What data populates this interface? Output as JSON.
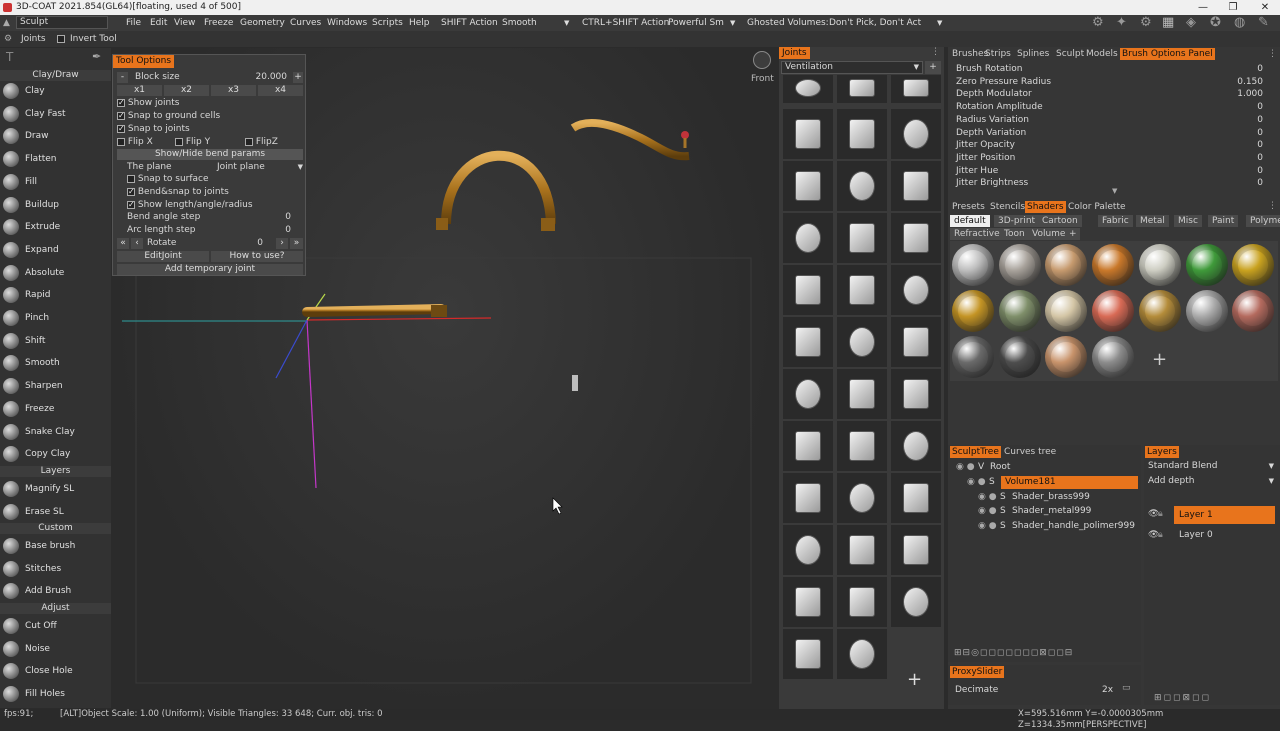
{
  "title": "3D-COAT 2021.854(GL64)[floating, used 4 of 500]",
  "menu": {
    "mode": "Sculpt",
    "items": [
      "File",
      "Edit",
      "View",
      "Freeze",
      "Geometry",
      "Curves",
      "Windows",
      "Scripts",
      "Help"
    ],
    "shift_action_label": "SHIFT Action",
    "shift_action_value": "Smooth",
    "ctrl_shift_label": "CTRL+SHIFT Action",
    "ctrl_shift_value": "Powerful Sm",
    "ghosted_label": "Ghosted Volumes:",
    "ghosted_value": "Don't Pick, Don't Act"
  },
  "row2": {
    "joints": "Joints",
    "invert_tool": "Invert Tool"
  },
  "left_tools": {
    "section_claydraw": "Clay/Draw",
    "claydraw": [
      "Clay",
      "Clay Fast",
      "Draw",
      "Flatten",
      "Fill",
      "Buildup",
      "Extrude",
      "Expand",
      "Absolute",
      "Rapid",
      "Pinch",
      "Shift",
      "Smooth",
      "Sharpen",
      "Freeze",
      "Snake Clay",
      "Copy Clay"
    ],
    "section_layers": "Layers",
    "layers": [
      "Magnify SL",
      "Erase SL"
    ],
    "section_custom": "Custom",
    "custom": [
      "Base brush",
      "Stitches",
      "Add Brush"
    ],
    "section_adjust": "Adjust",
    "adjust": [
      "Cut Off",
      "Noise",
      "Close Hole",
      "Fill Holes"
    ]
  },
  "tool_options": {
    "header": "Tool Options",
    "block_size_label": "Block size",
    "block_size_value": "20.000",
    "multipliers": [
      "x1",
      "x2",
      "x3",
      "x4"
    ],
    "show_joints": "Show joints",
    "snap_ground": "Snap to ground cells",
    "snap_joints": "Snap to joints",
    "flip_x": "Flip X",
    "flip_y": "Flip Y",
    "flip_z": "FlipZ",
    "show_hide_bend": "Show/Hide bend params",
    "the_plane_label": "The plane",
    "the_plane_value": "Joint plane",
    "snap_surface": "Snap to surface",
    "bend_snap": "Bend&snap to joints",
    "show_length": "Show length/angle/radius",
    "bend_angle_label": "Bend angle step",
    "bend_angle_value": "0",
    "arc_length_label": "Arc length step",
    "arc_length_value": "0",
    "rotate_label": "Rotate",
    "rotate_value": "0",
    "edit_joint": "EditJoint",
    "how_to_use": "How to use?",
    "add_temp_joint": "Add temporary joint"
  },
  "viewport": {
    "front_label": "Front"
  },
  "joints_panel": {
    "header": "Joints",
    "category": "Ventilation"
  },
  "brush_params": {
    "tabs": [
      "Brushes",
      "Strips",
      "Splines",
      "Sculpt",
      "Models",
      "Brush Options Panel"
    ],
    "params": [
      {
        "label": "Brush Rotation",
        "value": "0"
      },
      {
        "label": "Zero Pressure Radius",
        "value": "0.150"
      },
      {
        "label": "Depth Modulator",
        "value": "1.000"
      },
      {
        "label": "Rotation Amplitude",
        "value": "0"
      },
      {
        "label": "Radius Variation",
        "value": "0"
      },
      {
        "label": "Depth Variation",
        "value": "0"
      },
      {
        "label": "Jitter Opacity",
        "value": "0"
      },
      {
        "label": "Jitter Position",
        "value": "0"
      },
      {
        "label": "Jitter Hue",
        "value": "0"
      },
      {
        "label": "Jitter Brightness",
        "value": "0"
      }
    ]
  },
  "shaders_panel": {
    "tabs": [
      "Presets",
      "Stencils",
      "Shaders",
      "Color Palette"
    ],
    "subtabs": [
      "default",
      "3D-print",
      "Cartoon",
      "Fabric",
      "Metal",
      "Misc",
      "Paint",
      "Polymer",
      "Refractive",
      "Toon",
      "Volume"
    ],
    "colors": [
      "#bdbdbd",
      "#a8a29b",
      "#c69a6e",
      "#c9782a",
      "#cdcdc2",
      "#3f9a3a",
      "#c9a21f",
      "#c49424",
      "#7f8f6a",
      "#d4c6a6",
      "#d86a55",
      "#b48c3a",
      "#a9a9a9",
      "#b46a5e",
      "#6a6a6a",
      "#4d4d4d",
      "#c8936b",
      "#8c8c8c"
    ],
    "add": "+"
  },
  "sculpt_tree": {
    "tabs": [
      "SculptTree",
      "Curves tree"
    ],
    "nodes": [
      {
        "flag": "V",
        "label": "Root"
      },
      {
        "flag": "S",
        "label": "Volume181"
      },
      {
        "flag": "S",
        "label": "Shader_brass999"
      },
      {
        "flag": "S",
        "label": "Shader_metal999"
      },
      {
        "flag": "S",
        "label": "Shader_handle_polimer999"
      }
    ]
  },
  "layers_panel": {
    "tab": "Layers",
    "blend": "Standard Blend",
    "add_depth": "Add depth",
    "layers": [
      "Layer 1",
      "Layer 0"
    ]
  },
  "proxy": {
    "tab": "ProxySlider",
    "decimate_label": "Decimate",
    "decimate_value": "2x"
  },
  "status": {
    "fps": "fps:91;",
    "info": "[ALT]Object Scale: 1.00 (Uniform); Visible Triangles: 33 648; Curr. obj. tris: 0",
    "coords": "X=595.516mm  Y=-0.0000305mm  Z=1334.35mm[PERSPECTIVE]"
  }
}
